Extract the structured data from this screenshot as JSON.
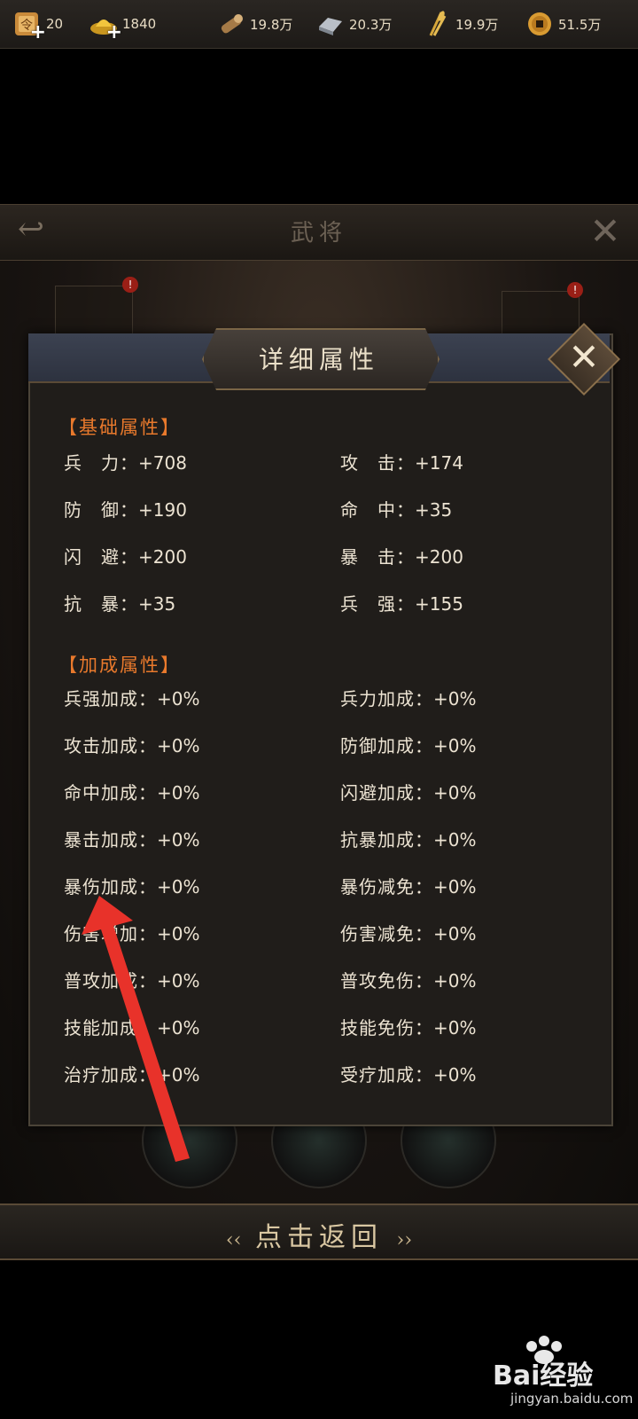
{
  "resources": [
    {
      "icon": "command-token-icon",
      "value": "20",
      "has_plus": true
    },
    {
      "icon": "gold-ingot-icon",
      "value": "1840",
      "has_plus": true
    },
    {
      "icon": "wood-icon",
      "value": "19.8万",
      "has_plus": false
    },
    {
      "icon": "iron-icon",
      "value": "20.3万",
      "has_plus": false
    },
    {
      "icon": "grain-icon",
      "value": "19.9万",
      "has_plus": false
    },
    {
      "icon": "coin-icon",
      "value": "51.5万",
      "has_plus": false
    }
  ],
  "scene": {
    "title": "武将"
  },
  "dialog": {
    "title": "详细属性",
    "basic": {
      "heading": "【基础属性】",
      "rows": [
        [
          {
            "label": "兵　力：",
            "value": "+708"
          },
          {
            "label": "攻　击：",
            "value": "+174"
          }
        ],
        [
          {
            "label": "防　御：",
            "value": "+190"
          },
          {
            "label": "命　中：",
            "value": "+35"
          }
        ],
        [
          {
            "label": "闪　避：",
            "value": "+200"
          },
          {
            "label": "暴　击：",
            "value": "+200"
          }
        ],
        [
          {
            "label": "抗　暴：",
            "value": "+35"
          },
          {
            "label": "兵　强：",
            "value": "+155"
          }
        ]
      ]
    },
    "bonus": {
      "heading": "【加成属性】",
      "rows": [
        [
          {
            "label": "兵强加成：",
            "value": "+0%"
          },
          {
            "label": "兵力加成：",
            "value": "+0%"
          }
        ],
        [
          {
            "label": "攻击加成：",
            "value": "+0%"
          },
          {
            "label": "防御加成：",
            "value": "+0%"
          }
        ],
        [
          {
            "label": "命中加成：",
            "value": "+0%"
          },
          {
            "label": "闪避加成：",
            "value": "+0%"
          }
        ],
        [
          {
            "label": "暴击加成：",
            "value": "+0%"
          },
          {
            "label": "抗暴加成：",
            "value": "+0%"
          }
        ],
        [
          {
            "label": "暴伤加成：",
            "value": "+0%"
          },
          {
            "label": "暴伤减免：",
            "value": "+0%"
          }
        ],
        [
          {
            "label": "伤害增加：",
            "value": "+0%"
          },
          {
            "label": "伤害减免：",
            "value": "+0%"
          }
        ],
        [
          {
            "label": "普攻加成：",
            "value": "+0%"
          },
          {
            "label": "普攻免伤：",
            "value": "+0%"
          }
        ],
        [
          {
            "label": "技能加成：",
            "value": "+0%"
          },
          {
            "label": "技能免伤：",
            "value": "+0%"
          }
        ],
        [
          {
            "label": "治疗加成：",
            "value": "+0%"
          },
          {
            "label": "受疗加成：",
            "value": "+0%"
          }
        ]
      ]
    }
  },
  "return_button": {
    "label": "点击返回"
  },
  "watermark": {
    "brand": "Bai经验",
    "domain": "jingyan.baidu.com"
  },
  "colors": {
    "section_heading": "#e8792c",
    "annotation_arrow": "#e8322a"
  }
}
